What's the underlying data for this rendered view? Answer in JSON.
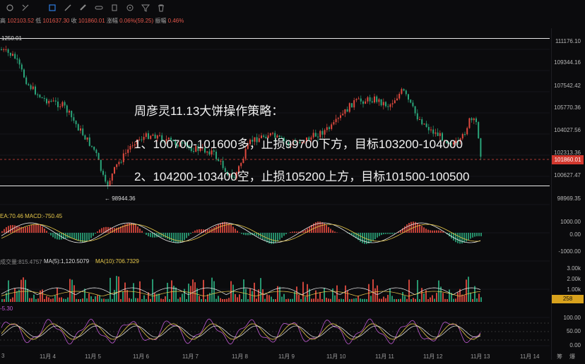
{
  "toolbar": {
    "icons": [
      "bars-icon",
      "tools-icon",
      "rectangle-icon",
      "pencil-icon",
      "ruler-icon",
      "link-icon",
      "text-icon",
      "indicator-icon",
      "filter-icon",
      "trash-icon"
    ],
    "active": "rectangle-icon"
  },
  "info_bar": {
    "high_label": "高",
    "high": "102103.52",
    "low_label": "低",
    "low": "101637.30",
    "close_label": "收",
    "close": "101860.01",
    "change_label": "涨幅",
    "change": "0.06%(59.25)",
    "amplitude_label": "振幅",
    "amplitude": "0.46%"
  },
  "annotations": {
    "top_left_price": "1250.01",
    "low_marker": "← 98944.36"
  },
  "strategy": {
    "title": "周彦灵11.13大饼操作策略：",
    "line1": "1、100700-101600多，止损99700下方，目标103200-104000",
    "line2": "2、104200-103400空，止损105200上方，目标101500-100500"
  },
  "price_axis": [
    "111176.10",
    "109344.16",
    "107542.42",
    "105770.36",
    "104027.56",
    "102313.36",
    "100627.47",
    "98969.35"
  ],
  "current_price": "101860.01",
  "macd": {
    "label": "EA:70.46  MACD:-750.45",
    "axis": [
      "1000.00",
      "0.00",
      "-1000.00"
    ]
  },
  "volume": {
    "label_prefix": "成交量:815.4757",
    "ma5": "MA(5):1,120.5079",
    "ma10": "MA(10):706.7329",
    "axis": [
      "3.00k",
      "2.00k",
      "1.00k",
      "258"
    ],
    "current": "258"
  },
  "rsi": {
    "label": "-5.30",
    "axis": [
      "100.00",
      "50.00",
      "0.00"
    ]
  },
  "time_axis": [
    "3",
    "11月 4",
    "11月 5",
    "11月 6",
    "11月 7",
    "11月 8",
    "11月 9",
    "11月 10",
    "11月 11",
    "11月 12",
    "11月 13",
    "11月 14"
  ],
  "corner_labels": [
    "筹",
    "爆"
  ],
  "colors": {
    "up": "#e04a3f",
    "down": "#2aa57a",
    "accent": "#2f7de1",
    "tag": "#d2382e",
    "vol_tag": "#d8a21d"
  }
}
